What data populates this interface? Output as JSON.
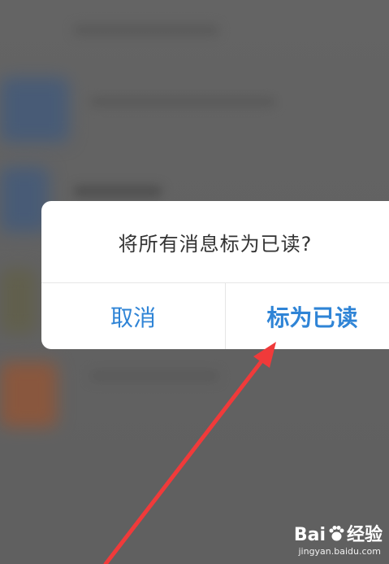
{
  "dialog": {
    "title": "将所有消息标为已读?",
    "cancel_label": "取消",
    "confirm_label": "标为已读"
  },
  "watermark": {
    "logo_text": "Bai",
    "logo_suffix": "经验",
    "url": "jingyan.baidu.com"
  },
  "colors": {
    "accent": "#2f84d6",
    "arrow": "#f03a3a",
    "overlay": "#6f6f6f"
  },
  "icons": {
    "arrow": "red-pointer-arrow-icon",
    "paw": "baidu-paw-icon"
  }
}
